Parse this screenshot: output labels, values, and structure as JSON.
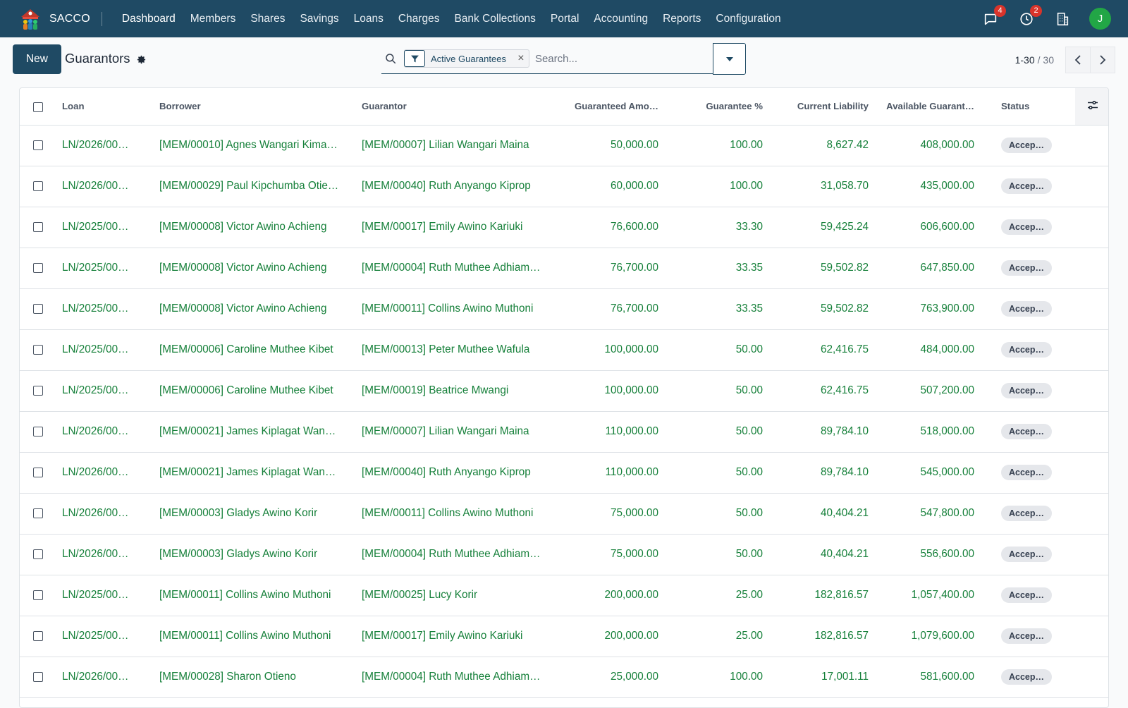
{
  "brand": {
    "name": "SACCO"
  },
  "nav": {
    "items": [
      "Dashboard",
      "Members",
      "Shares",
      "Savings",
      "Loans",
      "Charges",
      "Bank Collections",
      "Portal",
      "Accounting",
      "Reports",
      "Configuration"
    ],
    "messages_badge": "4",
    "activities_badge": "2",
    "avatar_initial": "J"
  },
  "control": {
    "new_label": "New",
    "title": "Guarantors",
    "facet_label": "Active Guarantees",
    "search_placeholder": "Search...",
    "pager_value": "1-30",
    "pager_total": "/ 30"
  },
  "table": {
    "columns": [
      "Loan",
      "Borrower",
      "Guarantor",
      "Guaranteed Amo…",
      "Guarantee %",
      "Current Liability",
      "Available Guarant…",
      "Status"
    ],
    "rows": [
      {
        "loan": "LN/2026/00…",
        "borrower": "[MEM/00010] Agnes Wangari Kima…",
        "guarantor": "[MEM/00007] Lilian Wangari Maina",
        "amount": "50,000.00",
        "pct": "100.00",
        "liability": "8,627.42",
        "available": "408,000.00",
        "status": "Accep…"
      },
      {
        "loan": "LN/2026/00…",
        "borrower": "[MEM/00029] Paul Kipchumba Otie…",
        "guarantor": "[MEM/00040] Ruth Anyango Kiprop",
        "amount": "60,000.00",
        "pct": "100.00",
        "liability": "31,058.70",
        "available": "435,000.00",
        "status": "Accep…"
      },
      {
        "loan": "LN/2025/00…",
        "borrower": "[MEM/00008] Victor Awino Achieng",
        "guarantor": "[MEM/00017] Emily Awino Kariuki",
        "amount": "76,600.00",
        "pct": "33.30",
        "liability": "59,425.24",
        "available": "606,600.00",
        "status": "Accep…"
      },
      {
        "loan": "LN/2025/00…",
        "borrower": "[MEM/00008] Victor Awino Achieng",
        "guarantor": "[MEM/00004] Ruth Muthee Adhiam…",
        "amount": "76,700.00",
        "pct": "33.35",
        "liability": "59,502.82",
        "available": "647,850.00",
        "status": "Accep…"
      },
      {
        "loan": "LN/2025/00…",
        "borrower": "[MEM/00008] Victor Awino Achieng",
        "guarantor": "[MEM/00011] Collins Awino Muthoni",
        "amount": "76,700.00",
        "pct": "33.35",
        "liability": "59,502.82",
        "available": "763,900.00",
        "status": "Accep…"
      },
      {
        "loan": "LN/2025/00…",
        "borrower": "[MEM/00006] Caroline Muthee Kibet",
        "guarantor": "[MEM/00013] Peter Muthee Wafula",
        "amount": "100,000.00",
        "pct": "50.00",
        "liability": "62,416.75",
        "available": "484,000.00",
        "status": "Accep…"
      },
      {
        "loan": "LN/2025/00…",
        "borrower": "[MEM/00006] Caroline Muthee Kibet",
        "guarantor": "[MEM/00019] Beatrice Mwangi",
        "amount": "100,000.00",
        "pct": "50.00",
        "liability": "62,416.75",
        "available": "507,200.00",
        "status": "Accep…"
      },
      {
        "loan": "LN/2026/00…",
        "borrower": "[MEM/00021] James Kiplagat Wan…",
        "guarantor": "[MEM/00007] Lilian Wangari Maina",
        "amount": "110,000.00",
        "pct": "50.00",
        "liability": "89,784.10",
        "available": "518,000.00",
        "status": "Accep…"
      },
      {
        "loan": "LN/2026/00…",
        "borrower": "[MEM/00021] James Kiplagat Wan…",
        "guarantor": "[MEM/00040] Ruth Anyango Kiprop",
        "amount": "110,000.00",
        "pct": "50.00",
        "liability": "89,784.10",
        "available": "545,000.00",
        "status": "Accep…"
      },
      {
        "loan": "LN/2026/00…",
        "borrower": "[MEM/00003] Gladys Awino Korir",
        "guarantor": "[MEM/00011] Collins Awino Muthoni",
        "amount": "75,000.00",
        "pct": "50.00",
        "liability": "40,404.21",
        "available": "547,800.00",
        "status": "Accep…"
      },
      {
        "loan": "LN/2026/00…",
        "borrower": "[MEM/00003] Gladys Awino Korir",
        "guarantor": "[MEM/00004] Ruth Muthee Adhiam…",
        "amount": "75,000.00",
        "pct": "50.00",
        "liability": "40,404.21",
        "available": "556,600.00",
        "status": "Accep…"
      },
      {
        "loan": "LN/2025/00…",
        "borrower": "[MEM/00011] Collins Awino Muthoni",
        "guarantor": "[MEM/00025] Lucy Korir",
        "amount": "200,000.00",
        "pct": "25.00",
        "liability": "182,816.57",
        "available": "1,057,400.00",
        "status": "Accep…"
      },
      {
        "loan": "LN/2025/00…",
        "borrower": "[MEM/00011] Collins Awino Muthoni",
        "guarantor": "[MEM/00017] Emily Awino Kariuki",
        "amount": "200,000.00",
        "pct": "25.00",
        "liability": "182,816.57",
        "available": "1,079,600.00",
        "status": "Accep…"
      },
      {
        "loan": "LN/2026/00…",
        "borrower": "[MEM/00028] Sharon Otieno",
        "guarantor": "[MEM/00004] Ruth Muthee Adhiam…",
        "amount": "25,000.00",
        "pct": "100.00",
        "liability": "17,001.11",
        "available": "581,600.00",
        "status": "Accep…"
      }
    ]
  },
  "colors": {
    "navbar": "#1f4a64",
    "link_green": "#16803a",
    "badge_red": "#d9342b",
    "avatar_green": "#22a646"
  },
  "icons": [
    "sacco-logo-icon",
    "chat-icon",
    "clock-icon",
    "building-icon",
    "gear-icon",
    "search-icon",
    "filter-icon",
    "close-icon",
    "caret-down-icon",
    "chevron-left-icon",
    "chevron-right-icon",
    "column-settings-icon"
  ]
}
